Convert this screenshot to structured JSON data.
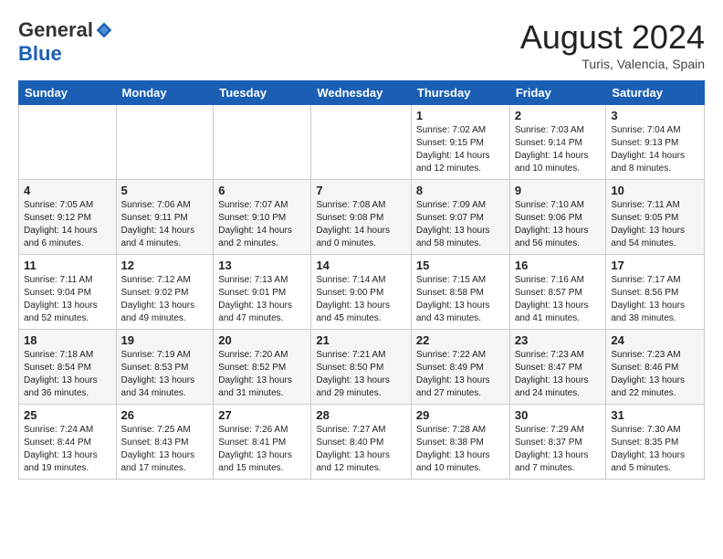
{
  "logo": {
    "general": "General",
    "blue": "Blue"
  },
  "title": {
    "month_year": "August 2024",
    "location": "Turis, Valencia, Spain"
  },
  "weekdays": [
    "Sunday",
    "Monday",
    "Tuesday",
    "Wednesday",
    "Thursday",
    "Friday",
    "Saturday"
  ],
  "weeks": [
    [
      {
        "day": "",
        "info": ""
      },
      {
        "day": "",
        "info": ""
      },
      {
        "day": "",
        "info": ""
      },
      {
        "day": "",
        "info": ""
      },
      {
        "day": "1",
        "info": "Sunrise: 7:02 AM\nSunset: 9:15 PM\nDaylight: 14 hours\nand 12 minutes."
      },
      {
        "day": "2",
        "info": "Sunrise: 7:03 AM\nSunset: 9:14 PM\nDaylight: 14 hours\nand 10 minutes."
      },
      {
        "day": "3",
        "info": "Sunrise: 7:04 AM\nSunset: 9:13 PM\nDaylight: 14 hours\nand 8 minutes."
      }
    ],
    [
      {
        "day": "4",
        "info": "Sunrise: 7:05 AM\nSunset: 9:12 PM\nDaylight: 14 hours\nand 6 minutes."
      },
      {
        "day": "5",
        "info": "Sunrise: 7:06 AM\nSunset: 9:11 PM\nDaylight: 14 hours\nand 4 minutes."
      },
      {
        "day": "6",
        "info": "Sunrise: 7:07 AM\nSunset: 9:10 PM\nDaylight: 14 hours\nand 2 minutes."
      },
      {
        "day": "7",
        "info": "Sunrise: 7:08 AM\nSunset: 9:08 PM\nDaylight: 14 hours\nand 0 minutes."
      },
      {
        "day": "8",
        "info": "Sunrise: 7:09 AM\nSunset: 9:07 PM\nDaylight: 13 hours\nand 58 minutes."
      },
      {
        "day": "9",
        "info": "Sunrise: 7:10 AM\nSunset: 9:06 PM\nDaylight: 13 hours\nand 56 minutes."
      },
      {
        "day": "10",
        "info": "Sunrise: 7:11 AM\nSunset: 9:05 PM\nDaylight: 13 hours\nand 54 minutes."
      }
    ],
    [
      {
        "day": "11",
        "info": "Sunrise: 7:11 AM\nSunset: 9:04 PM\nDaylight: 13 hours\nand 52 minutes."
      },
      {
        "day": "12",
        "info": "Sunrise: 7:12 AM\nSunset: 9:02 PM\nDaylight: 13 hours\nand 49 minutes."
      },
      {
        "day": "13",
        "info": "Sunrise: 7:13 AM\nSunset: 9:01 PM\nDaylight: 13 hours\nand 47 minutes."
      },
      {
        "day": "14",
        "info": "Sunrise: 7:14 AM\nSunset: 9:00 PM\nDaylight: 13 hours\nand 45 minutes."
      },
      {
        "day": "15",
        "info": "Sunrise: 7:15 AM\nSunset: 8:58 PM\nDaylight: 13 hours\nand 43 minutes."
      },
      {
        "day": "16",
        "info": "Sunrise: 7:16 AM\nSunset: 8:57 PM\nDaylight: 13 hours\nand 41 minutes."
      },
      {
        "day": "17",
        "info": "Sunrise: 7:17 AM\nSunset: 8:56 PM\nDaylight: 13 hours\nand 38 minutes."
      }
    ],
    [
      {
        "day": "18",
        "info": "Sunrise: 7:18 AM\nSunset: 8:54 PM\nDaylight: 13 hours\nand 36 minutes."
      },
      {
        "day": "19",
        "info": "Sunrise: 7:19 AM\nSunset: 8:53 PM\nDaylight: 13 hours\nand 34 minutes."
      },
      {
        "day": "20",
        "info": "Sunrise: 7:20 AM\nSunset: 8:52 PM\nDaylight: 13 hours\nand 31 minutes."
      },
      {
        "day": "21",
        "info": "Sunrise: 7:21 AM\nSunset: 8:50 PM\nDaylight: 13 hours\nand 29 minutes."
      },
      {
        "day": "22",
        "info": "Sunrise: 7:22 AM\nSunset: 8:49 PM\nDaylight: 13 hours\nand 27 minutes."
      },
      {
        "day": "23",
        "info": "Sunrise: 7:23 AM\nSunset: 8:47 PM\nDaylight: 13 hours\nand 24 minutes."
      },
      {
        "day": "24",
        "info": "Sunrise: 7:23 AM\nSunset: 8:46 PM\nDaylight: 13 hours\nand 22 minutes."
      }
    ],
    [
      {
        "day": "25",
        "info": "Sunrise: 7:24 AM\nSunset: 8:44 PM\nDaylight: 13 hours\nand 19 minutes."
      },
      {
        "day": "26",
        "info": "Sunrise: 7:25 AM\nSunset: 8:43 PM\nDaylight: 13 hours\nand 17 minutes."
      },
      {
        "day": "27",
        "info": "Sunrise: 7:26 AM\nSunset: 8:41 PM\nDaylight: 13 hours\nand 15 minutes."
      },
      {
        "day": "28",
        "info": "Sunrise: 7:27 AM\nSunset: 8:40 PM\nDaylight: 13 hours\nand 12 minutes."
      },
      {
        "day": "29",
        "info": "Sunrise: 7:28 AM\nSunset: 8:38 PM\nDaylight: 13 hours\nand 10 minutes."
      },
      {
        "day": "30",
        "info": "Sunrise: 7:29 AM\nSunset: 8:37 PM\nDaylight: 13 hours\nand 7 minutes."
      },
      {
        "day": "31",
        "info": "Sunrise: 7:30 AM\nSunset: 8:35 PM\nDaylight: 13 hours\nand 5 minutes."
      }
    ]
  ]
}
